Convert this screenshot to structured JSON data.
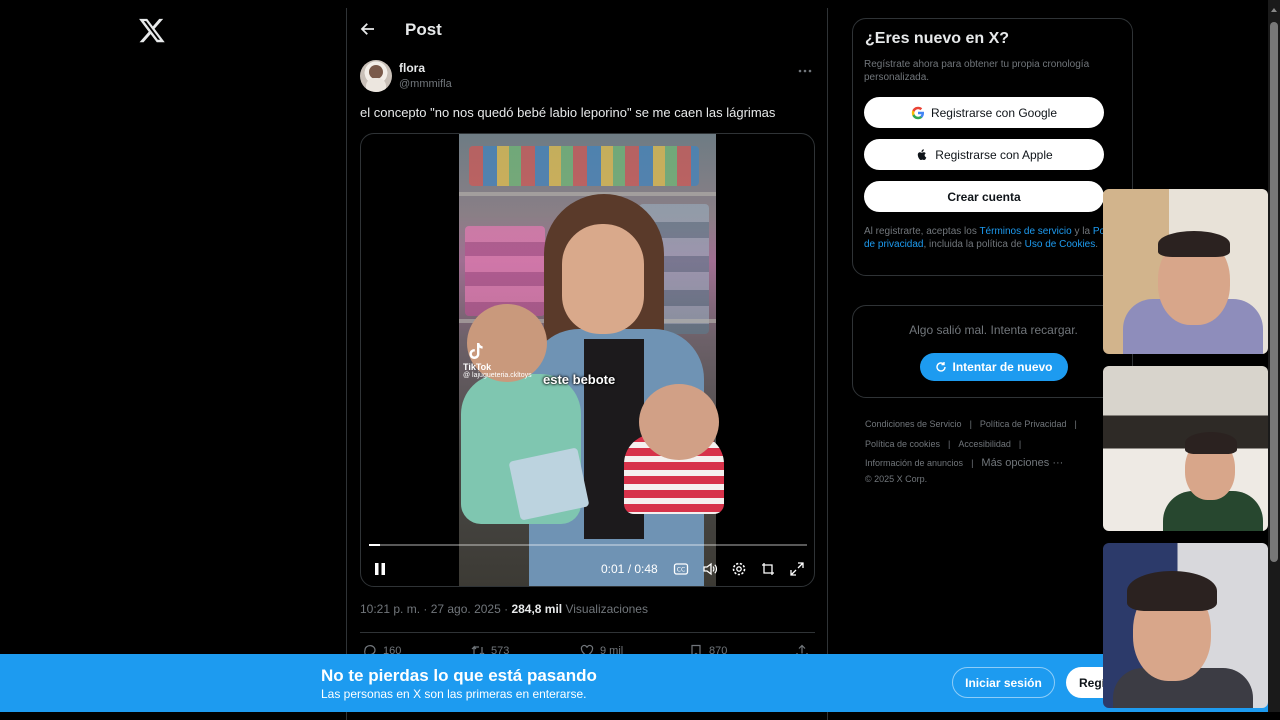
{
  "post_header": {
    "title": "Post"
  },
  "author": {
    "name": "flora",
    "handle": "@mmmifla"
  },
  "post": {
    "text": "el concepto \"no nos quedó bebé labio leporino\" se me caen las lágrimas",
    "video": {
      "caption": "este bebote",
      "watermark_label": "TikTok",
      "watermark_handle": "@ lajugueteria.ckltoys",
      "time": "0:01 / 0:48",
      "progress_fraction": 0.025
    },
    "meta": {
      "time": "10:21 p. m. · 27 ago. 2025 · ",
      "views": "284,8 mil",
      "views_label": " Visualizaciones"
    },
    "actions": {
      "replies": "160",
      "reposts": "573",
      "likes": "9 mil",
      "bookmarks": "870"
    }
  },
  "signup": {
    "title": "¿Eres nuevo en X?",
    "subtitle": "Regístrate ahora para obtener tu propia cronología personalizada.",
    "google_label": "Registrarse con Google",
    "apple_label": "Registrarse con Apple",
    "create_label": "Crear cuenta",
    "legal_prefix": "Al registrarte, aceptas los ",
    "terms": "Términos de servicio",
    "legal_mid1": " y la ",
    "privacy": "Política de privacidad",
    "legal_mid2": ", incluida la política de ",
    "cookies": "Uso de Cookies",
    "legal_end": "."
  },
  "error_card": {
    "message": "Algo salió mal. Intenta recargar.",
    "retry_label": "Intentar de nuevo"
  },
  "footer": {
    "terms": "Condiciones de Servicio",
    "privacy": "Política de Privacidad",
    "cookies": "Política de cookies",
    "accessibility": "Accesibilidad",
    "ads": "Información de anuncios",
    "more": "Más opciones ···",
    "copyright": "© 2025 X Corp."
  },
  "banner": {
    "title": "No te pierdas lo que está pasando",
    "subtitle": "Las personas en X son las primeras en enterarse.",
    "login_label": "Iniciar sesión",
    "register_label": "Regístrate"
  },
  "colors": {
    "accent": "#1d9bf0",
    "background": "#000000",
    "border": "#2f3336",
    "muted": "#71767b"
  }
}
